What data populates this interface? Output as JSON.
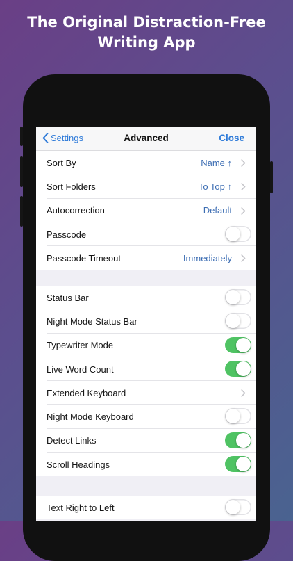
{
  "headline": {
    "line1": "The Original Distraction-Free",
    "line2": "Writing App"
  },
  "navbar": {
    "back_label": "Settings",
    "title": "Advanced",
    "close_label": "Close"
  },
  "group1": [
    {
      "label": "Sort By",
      "value": "Name ↑",
      "type": "disclosure"
    },
    {
      "label": "Sort Folders",
      "value": "To Top ↑",
      "type": "disclosure"
    },
    {
      "label": "Autocorrection",
      "value": "Default",
      "type": "disclosure"
    },
    {
      "label": "Passcode",
      "type": "toggle",
      "on": false
    },
    {
      "label": "Passcode Timeout",
      "value": "Immediately",
      "type": "disclosure"
    }
  ],
  "group2": [
    {
      "label": "Status Bar",
      "type": "toggle",
      "on": false
    },
    {
      "label": "Night Mode Status Bar",
      "type": "toggle",
      "on": false
    },
    {
      "label": "Typewriter Mode",
      "type": "toggle",
      "on": true
    },
    {
      "label": "Live Word Count",
      "type": "toggle",
      "on": true
    },
    {
      "label": "Extended Keyboard",
      "type": "disclosure"
    },
    {
      "label": "Night Mode Keyboard",
      "type": "toggle",
      "on": false
    },
    {
      "label": "Detect Links",
      "type": "toggle",
      "on": true
    },
    {
      "label": "Scroll Headings",
      "type": "toggle",
      "on": true
    }
  ],
  "group3": [
    {
      "label": "Text Right to Left",
      "type": "toggle",
      "on": false
    }
  ],
  "colors": {
    "accent": "#2f7bd9",
    "value_text": "#3c6db3",
    "toggle_on": "#4fc363",
    "grouped_background": "#f0eff5"
  },
  "icons": {
    "back": "chevron-left-icon",
    "disclosure": "chevron-right-icon"
  }
}
